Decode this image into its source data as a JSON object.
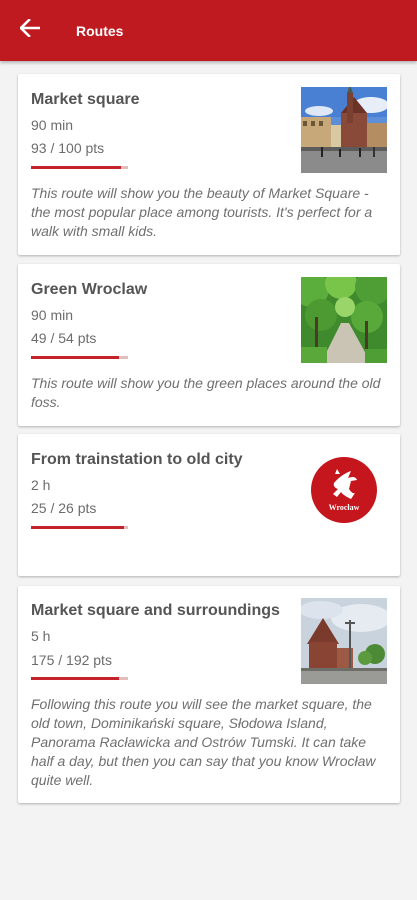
{
  "appbar": {
    "title": "Routes",
    "back_icon": "arrow-left-icon",
    "background": "#bf1a20"
  },
  "routes": [
    {
      "title": "Market square",
      "time": "90 min",
      "points": "93 / 100 pts",
      "progress": 0.93,
      "description": "This route will show you the beauty of Market Square - the most popular place among tourists. It's perfect for a walk with small kids.",
      "thumbnail": "market-square-photo"
    },
    {
      "title": "Green Wroclaw",
      "time": "90 min",
      "points": "49 / 54 pts",
      "progress": 0.907,
      "description": "This route will show you the green places around the old foss.",
      "thumbnail": "green-alley-photo"
    },
    {
      "title": "From trainstation to old city",
      "time": "2 h",
      "points": "25 / 26 pts",
      "progress": 0.96,
      "description": "",
      "thumbnail": "wroclaw-logo",
      "logo_text": "Wrocław"
    },
    {
      "title": "Market square and surroundings",
      "time": "5 h",
      "points": "175 / 192 pts",
      "progress": 0.911,
      "description": "Following this route you will see the market square, the old town, Dominikański square, Słodowa Island, Panorama Racławicka and Ostrów Tumski. It can take half a day, but then you can say that you know Wrocław quite well.",
      "thumbnail": "church-tower-photo"
    }
  ],
  "colors": {
    "accent": "#c4232a",
    "progress_track": "#e3bcbd",
    "page_background": "#f3f3f3"
  }
}
